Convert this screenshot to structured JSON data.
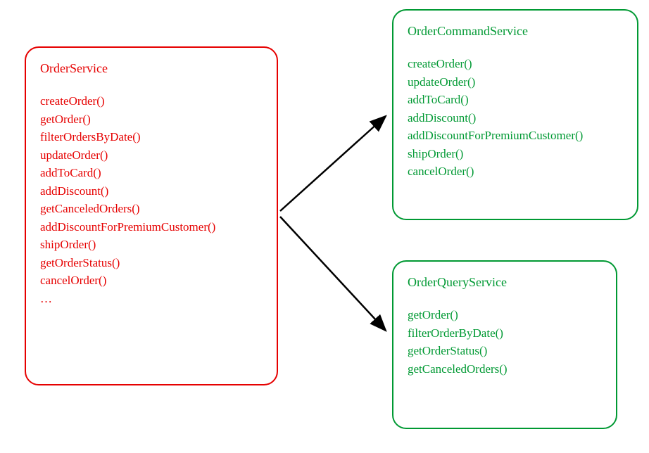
{
  "left": {
    "title": "OrderService",
    "methods": [
      "createOrder()",
      "getOrder()",
      "filterOrdersByDate()",
      "updateOrder()",
      "addToCard()",
      "addDiscount()",
      "getCanceledOrders()",
      "addDiscountForPremiumCustomer()",
      "shipOrder()",
      "getOrderStatus()",
      "cancelOrder()",
      "…"
    ]
  },
  "topRight": {
    "title": "OrderCommandService",
    "methods": [
      "createOrder()",
      "updateOrder()",
      "addToCard()",
      "addDiscount()",
      "addDiscountForPremiumCustomer()",
      "shipOrder()",
      "cancelOrder()"
    ]
  },
  "bottomRight": {
    "title": "OrderQueryService",
    "methods": [
      "getOrder()",
      "filterOrderByDate()",
      "getOrderStatus()",
      "getCanceledOrders()"
    ]
  }
}
